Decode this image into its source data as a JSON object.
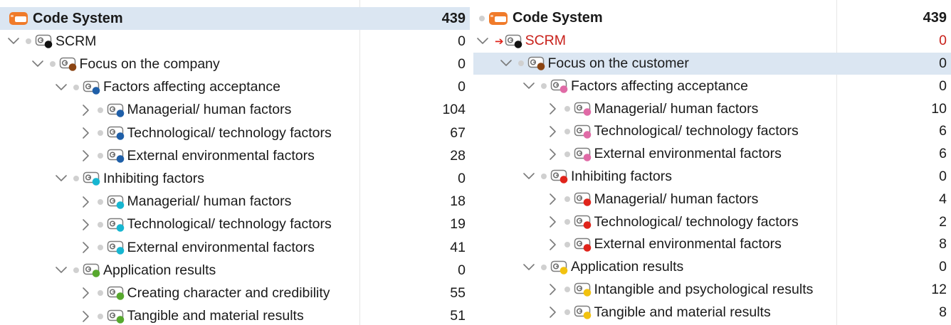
{
  "colors": {
    "black": "#111111",
    "brown": "#8b4513",
    "blue": "#1f5fa8",
    "cyan": "#17b6d1",
    "green": "#57a82e",
    "pink": "#e06aa6",
    "red": "#e0241b",
    "yellow": "#f2c20f",
    "system_orange": "#f07b2a"
  },
  "left_panel": {
    "header": {
      "label": "Code System",
      "count": "439",
      "icon": "code-system-icon"
    },
    "rows": [
      {
        "label": "SCRM",
        "count": "0",
        "level": 0,
        "chevron": "down",
        "color": "black",
        "name": "scrm"
      },
      {
        "label": "Focus on the company",
        "count": "0",
        "level": 1,
        "chevron": "down",
        "color": "brown",
        "name": "focus-on-the-company"
      },
      {
        "label": "Factors affecting acceptance",
        "count": "0",
        "level": 2,
        "chevron": "down",
        "color": "blue",
        "name": "factors-affecting-acceptance"
      },
      {
        "label": "Managerial/ human factors",
        "count": "104",
        "level": 3,
        "chevron": "right",
        "color": "blue",
        "name": "managerial-human-factors"
      },
      {
        "label": "Technological/  technology factors",
        "count": "67",
        "level": 3,
        "chevron": "right",
        "color": "blue",
        "name": "technological-technology-factors"
      },
      {
        "label": "External environmental factors",
        "count": "28",
        "level": 3,
        "chevron": "right",
        "color": "blue",
        "name": "external-environmental-factors"
      },
      {
        "label": "Inhibiting factors",
        "count": "0",
        "level": 2,
        "chevron": "down",
        "color": "cyan",
        "name": "inhibiting-factors"
      },
      {
        "label": "Managerial/ human factors",
        "count": "18",
        "level": 3,
        "chevron": "right",
        "color": "cyan",
        "name": "managerial-human-factors"
      },
      {
        "label": "Technological/  technology factors",
        "count": "19",
        "level": 3,
        "chevron": "right",
        "color": "cyan",
        "name": "technological-technology-factors"
      },
      {
        "label": "External environmental factors",
        "count": "41",
        "level": 3,
        "chevron": "right",
        "color": "cyan",
        "name": "external-environmental-factors"
      },
      {
        "label": "Application results",
        "count": "0",
        "level": 2,
        "chevron": "down",
        "color": "green",
        "name": "application-results"
      },
      {
        "label": "Creating character and credibility",
        "count": "55",
        "level": 3,
        "chevron": "right",
        "color": "green",
        "name": "creating-character-and-credibility"
      },
      {
        "label": "Tangible and material results",
        "count": "51",
        "level": 3,
        "chevron": "right",
        "color": "green",
        "name": "tangible-and-material-results"
      }
    ]
  },
  "right_panel": {
    "header": {
      "label": "Code System",
      "count": "439",
      "icon": "code-system-icon"
    },
    "rows": [
      {
        "label": "SCRM",
        "count": "0",
        "level": 0,
        "chevron": "down",
        "color": "black",
        "name": "scrm",
        "red": true
      },
      {
        "label": "Focus on the customer",
        "count": "0",
        "level": 1,
        "chevron": "down",
        "color": "brown",
        "name": "focus-on-the-customer",
        "selected": true
      },
      {
        "label": "Factors affecting acceptance",
        "count": "0",
        "level": 2,
        "chevron": "down",
        "color": "pink",
        "name": "factors-affecting-acceptance"
      },
      {
        "label": "Managerial/ human factors",
        "count": "10",
        "level": 3,
        "chevron": "right",
        "color": "pink",
        "name": "managerial-human-factors"
      },
      {
        "label": "Technological/ technology factors",
        "count": "6",
        "level": 3,
        "chevron": "right",
        "color": "pink",
        "name": "technological-technology-factors"
      },
      {
        "label": "External environmental factors",
        "count": "6",
        "level": 3,
        "chevron": "right",
        "color": "pink",
        "name": "external-environmental-factors"
      },
      {
        "label": "Inhibiting factors",
        "count": "0",
        "level": 2,
        "chevron": "down",
        "color": "red",
        "name": "inhibiting-factors"
      },
      {
        "label": "Managerial/ human factors",
        "count": "4",
        "level": 3,
        "chevron": "right",
        "color": "red",
        "name": "managerial-human-factors"
      },
      {
        "label": "Technological/ technology factors",
        "count": "2",
        "level": 3,
        "chevron": "right",
        "color": "red",
        "name": "technological-technology-factors"
      },
      {
        "label": "External environmental factors",
        "count": "8",
        "level": 3,
        "chevron": "right",
        "color": "red",
        "name": "external-environmental-factors"
      },
      {
        "label": "Application results",
        "count": "0",
        "level": 2,
        "chevron": "down",
        "color": "yellow",
        "name": "application-results"
      },
      {
        "label": "Intangible and psychological results",
        "count": "12",
        "level": 3,
        "chevron": "right",
        "color": "yellow",
        "name": "intangible-and-psychological-results"
      },
      {
        "label": "Tangible and material results",
        "count": "8",
        "level": 3,
        "chevron": "right",
        "color": "yellow",
        "name": "tangible-and-material-results"
      }
    ]
  }
}
